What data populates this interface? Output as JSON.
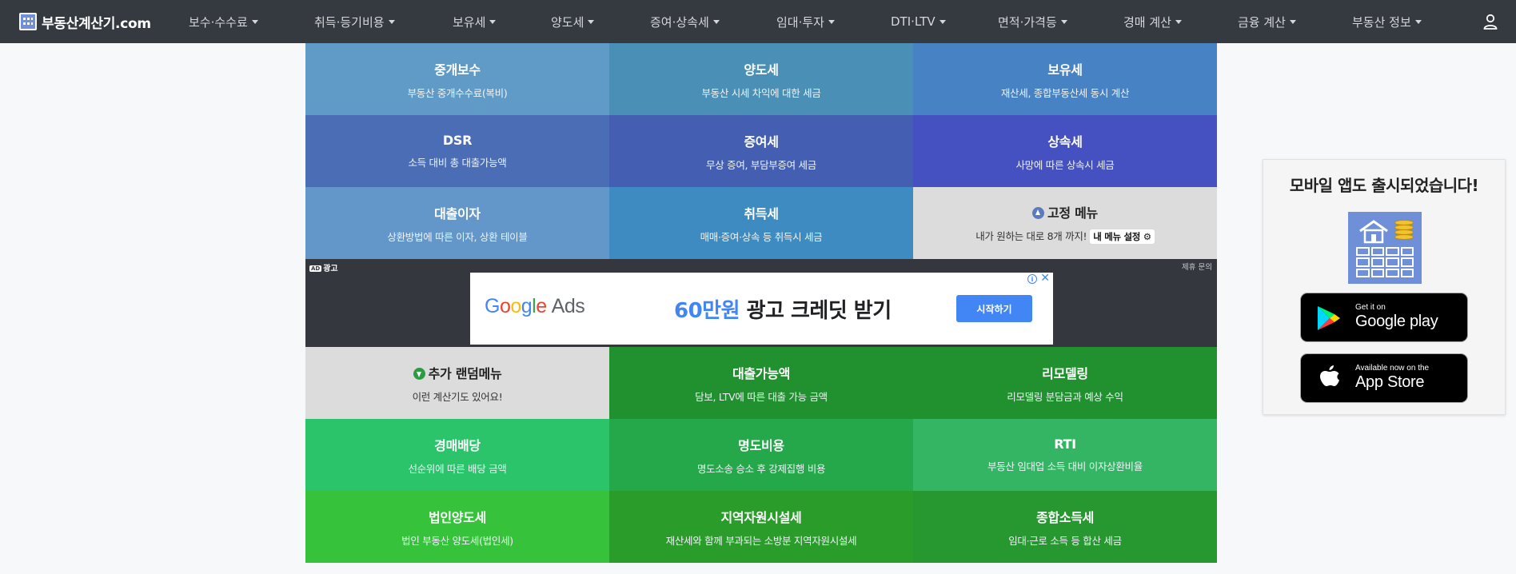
{
  "navbar": {
    "brand": "부동산계산기.com",
    "items": [
      {
        "label": "보수·수수료"
      },
      {
        "label": "취득·등기비용"
      },
      {
        "label": "보유세"
      },
      {
        "label": "양도세"
      },
      {
        "label": "증여·상속세"
      },
      {
        "label": "임대·투자"
      },
      {
        "label": "DTI·LTV"
      },
      {
        "label": "면적·가격등"
      },
      {
        "label": "경매 계산"
      },
      {
        "label": "금융 계산"
      },
      {
        "label": "부동산 정보"
      }
    ],
    "user_icon": "user-icon"
  },
  "top_grid": [
    {
      "title": "중개보수",
      "sub": "부동산 중개수수료(복비)",
      "color": "#5f9bc6"
    },
    {
      "title": "양도세",
      "sub": "부동산 시세 차익에 대한 세금",
      "color": "#4a8fb6"
    },
    {
      "title": "보유세",
      "sub": "재산세, 종합부동산세 동시 계산",
      "color": "#4682c4"
    },
    {
      "title": "DSR",
      "sub": "소득 대비 총 대출가능액",
      "color": "#4a6db5"
    },
    {
      "title": "증여세",
      "sub": "무상 증여, 부담부증여 세금",
      "color": "#445fb1"
    },
    {
      "title": "상속세",
      "sub": "사망에 따른 상속시 세금",
      "color": "#4651c1"
    },
    {
      "title": "대출이자",
      "sub": "상환방법에 따른 이자, 상환 테이블",
      "color": "#6397c9"
    },
    {
      "title": "취득세",
      "sub": "매매·증여·상속 등 취득시 세금",
      "color": "#3d8bc0"
    }
  ],
  "pinned_menu": {
    "title": "고정 메뉴",
    "sub": "내가 원하는 대로 8개 까지!",
    "button": "내 메뉴 설정",
    "icon": "arrow-up-circle-icon",
    "gear_icon": "gear-icon"
  },
  "ad": {
    "label": "광고",
    "badge": "AD",
    "inquiry": "제휴 문의",
    "google": "Google",
    "ads": "Ads",
    "headline_highlight": "60만원",
    "headline_rest": " 광고 크레딧 받기",
    "cta": "시작하기",
    "info_icon": "i",
    "close_icon": "✕"
  },
  "random_menu": {
    "title": "추가 랜덤메뉴",
    "sub": "이런 계산기도 있어요!",
    "icon": "arrow-down-circle-icon"
  },
  "bottom_grid": [
    {
      "title": "대출가능액",
      "sub": "담보, LTV에 따른 대출 가능 금액",
      "color": "#21902f"
    },
    {
      "title": "리모델링",
      "sub": "리모델링 분담금과 예상 수익",
      "color": "#21902f"
    },
    {
      "title": "경매배당",
      "sub": "선순위에 따른 배당 금액",
      "color": "#2bc46a"
    },
    {
      "title": "명도비용",
      "sub": "명도소송 승소 후 강제집행 비용",
      "color": "#25a84a"
    },
    {
      "title": "RTI",
      "sub": "부동산 임대업 소득 대비 이자상환비율",
      "color": "#33b564"
    },
    {
      "title": "법인양도세",
      "sub": "법인 부동산 양도세(법인세)",
      "color": "#37c23b"
    },
    {
      "title": "지역자원시설세",
      "sub": "재산세와 함께 부과되는 소방분 지역자원시설세",
      "color": "#2a9c2a"
    },
    {
      "title": "종합소득세",
      "sub": "임대·근로 소득 등 합산 세금",
      "color": "#27972f"
    }
  ],
  "app_promo": {
    "title": "모바일 앱도 출시되었습니다!",
    "google_small": "Get it on",
    "google_big": "Google play",
    "apple_small": "Available now on the",
    "apple_big": "App Store"
  }
}
